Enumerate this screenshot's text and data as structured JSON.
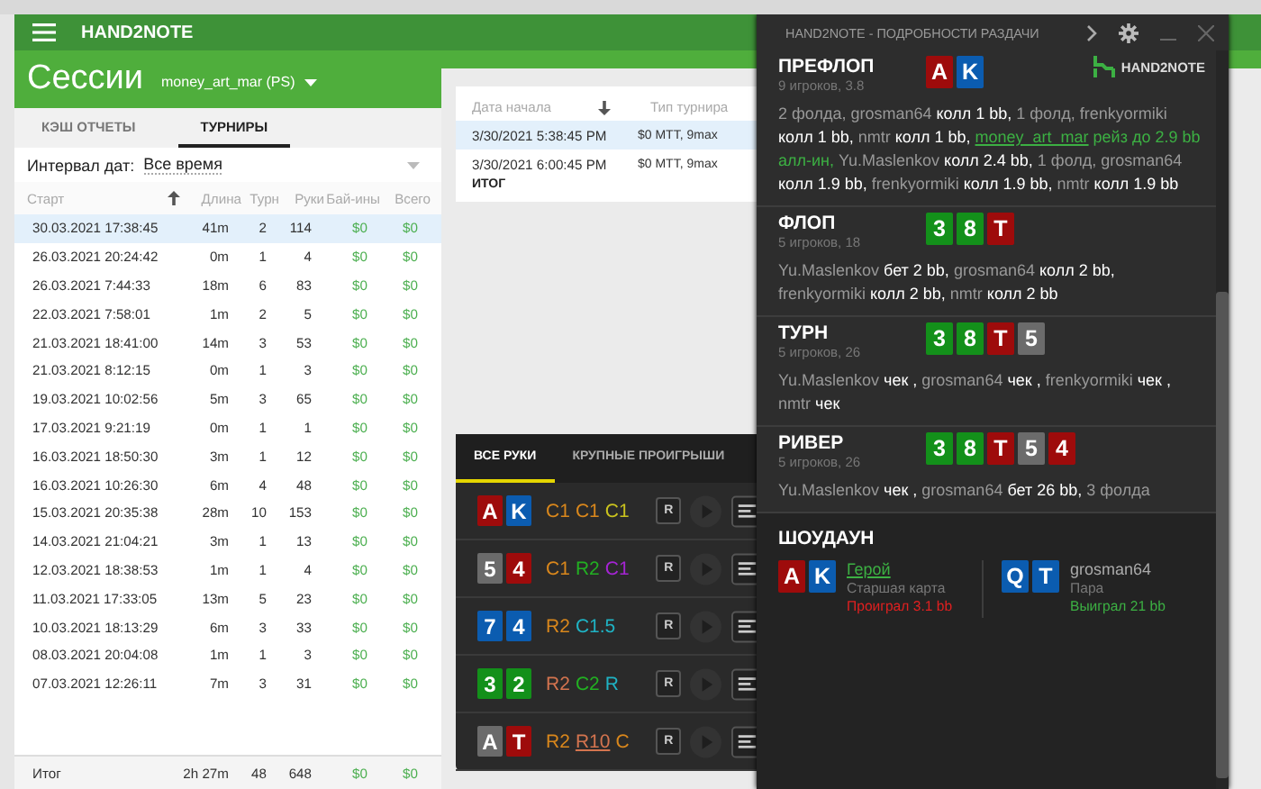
{
  "main_window": {
    "title": "HAND2NOTE",
    "heading": "Сессии",
    "account": "money_art_mar (PS)",
    "tabs": [
      {
        "label": "КЭШ ОТЧЕТЫ",
        "selected": false
      },
      {
        "label": "ТУРНИРЫ",
        "selected": true
      }
    ],
    "date_filter": {
      "label": "Интервал дат:",
      "value": "Все время"
    },
    "sessions": {
      "columns": [
        "Старт",
        "Длина",
        "Турн",
        "Руки",
        "Бай-ины",
        "Всего"
      ],
      "rows": [
        {
          "cells": [
            "30.03.2021 17:38:45",
            "41m",
            "2",
            "114",
            "$0",
            "$0"
          ],
          "selected": true
        },
        {
          "cells": [
            "26.03.2021 20:24:42",
            "0m",
            "1",
            "4",
            "$0",
            "$0"
          ],
          "selected": false
        },
        {
          "cells": [
            "26.03.2021 7:44:33",
            "18m",
            "6",
            "83",
            "$0",
            "$0"
          ],
          "selected": false
        },
        {
          "cells": [
            "22.03.2021 7:58:01",
            "1m",
            "2",
            "5",
            "$0",
            "$0"
          ],
          "selected": false
        },
        {
          "cells": [
            "21.03.2021 18:41:00",
            "14m",
            "3",
            "53",
            "$0",
            "$0"
          ],
          "selected": false
        },
        {
          "cells": [
            "21.03.2021 8:12:15",
            "0m",
            "1",
            "3",
            "$0",
            "$0"
          ],
          "selected": false
        },
        {
          "cells": [
            "19.03.2021 10:02:56",
            "5m",
            "3",
            "65",
            "$0",
            "$0"
          ],
          "selected": false
        },
        {
          "cells": [
            "17.03.2021 9:21:19",
            "0m",
            "1",
            "1",
            "$0",
            "$0"
          ],
          "selected": false
        },
        {
          "cells": [
            "16.03.2021 18:50:30",
            "3m",
            "1",
            "12",
            "$0",
            "$0"
          ],
          "selected": false
        },
        {
          "cells": [
            "16.03.2021 10:26:30",
            "6m",
            "4",
            "48",
            "$0",
            "$0"
          ],
          "selected": false
        },
        {
          "cells": [
            "15.03.2021 20:35:38",
            "28m",
            "10",
            "153",
            "$0",
            "$0"
          ],
          "selected": false
        },
        {
          "cells": [
            "14.03.2021 21:04:21",
            "3m",
            "1",
            "13",
            "$0",
            "$0"
          ],
          "selected": false
        },
        {
          "cells": [
            "12.03.2021 18:38:53",
            "1m",
            "1",
            "4",
            "$0",
            "$0"
          ],
          "selected": false
        },
        {
          "cells": [
            "11.03.2021 17:33:05",
            "13m",
            "5",
            "23",
            "$0",
            "$0"
          ],
          "selected": false
        },
        {
          "cells": [
            "10.03.2021 18:13:29",
            "6m",
            "3",
            "33",
            "$0",
            "$0"
          ],
          "selected": false
        },
        {
          "cells": [
            "08.03.2021 20:04:08",
            "1m",
            "1",
            "3",
            "$0",
            "$0"
          ],
          "selected": false
        },
        {
          "cells": [
            "07.03.2021 12:26:11",
            "7m",
            "3",
            "31",
            "$0",
            "$0"
          ],
          "selected": false
        }
      ],
      "totals": [
        "Итог",
        "2h 27m",
        "48",
        "648",
        "$0",
        "$0"
      ]
    },
    "tournaments": {
      "columns": [
        "Дата начала",
        "Тип турнира"
      ],
      "rows": [
        {
          "cells": [
            "3/30/2021 5:38:45 PM",
            "$0 MTT, 9max"
          ],
          "selected": true
        },
        {
          "cells": [
            "3/30/2021 6:00:45 PM",
            "$0 MTT, 9max"
          ],
          "selected": false
        }
      ],
      "total_label": "ИТОГ"
    }
  },
  "hands_panel": {
    "tabs": [
      {
        "label": "ВСЕ РУКИ",
        "selected": true
      },
      {
        "label": "КРУПНЫЕ ПРОИГРЫШИ",
        "selected": false
      }
    ],
    "hands": [
      {
        "replay_label": "R",
        "cards": [
          {
            "rank": "A",
            "color": "#9e0b0b"
          },
          {
            "rank": "K",
            "color": "#0b5cb0"
          }
        ],
        "actions": [
          {
            "text": "C1",
            "color": "#d9871c",
            "underlined": false
          },
          {
            "text": "C1",
            "color": "#d9871c",
            "underlined": false
          },
          {
            "text": "C1",
            "color": "#c9c21e",
            "underlined": false
          }
        ]
      },
      {
        "replay_label": "R",
        "cards": [
          {
            "rank": "5",
            "color": "#6b6b6b"
          },
          {
            "rank": "4",
            "color": "#9e0b0b"
          }
        ],
        "actions": [
          {
            "text": "C1",
            "color": "#d9871c",
            "underlined": false
          },
          {
            "text": "R2",
            "color": "#22b022",
            "underlined": false
          },
          {
            "text": "C1",
            "color": "#a524d4",
            "underlined": false
          }
        ]
      },
      {
        "replay_label": "R",
        "cards": [
          {
            "rank": "7",
            "color": "#0b5cb0"
          },
          {
            "rank": "4",
            "color": "#0b5cb0"
          }
        ],
        "actions": [
          {
            "text": "R2",
            "color": "#d9871c",
            "underlined": false
          },
          {
            "text": "C1.5",
            "color": "#1fb3c4",
            "underlined": false
          }
        ]
      },
      {
        "replay_label": "R",
        "cards": [
          {
            "rank": "3",
            "color": "#13901a"
          },
          {
            "rank": "2",
            "color": "#13901a"
          }
        ],
        "actions": [
          {
            "text": "R2",
            "color": "#d4744f",
            "underlined": false
          },
          {
            "text": "C2",
            "color": "#22b022",
            "underlined": false
          },
          {
            "text": "R",
            "color": "#1fb3c4",
            "underlined": false
          }
        ]
      },
      {
        "replay_label": "R",
        "cards": [
          {
            "rank": "A",
            "color": "#6b6b6b"
          },
          {
            "rank": "T",
            "color": "#9e0b0b"
          }
        ],
        "actions": [
          {
            "text": "R2",
            "color": "#d9871c",
            "underlined": false
          },
          {
            "text": "R10",
            "color": "#d4744f",
            "underlined": true
          },
          {
            "text": "C",
            "color": "#d9871c",
            "underlined": false
          }
        ]
      }
    ]
  },
  "hand_details": {
    "title": "HAND2NOTE - ПОДРОБНОСТИ РАЗДАЧИ",
    "logo": "HAND2NOTE",
    "streets": [
      {
        "name": "ПРЕФЛОП",
        "info": "9 игроков, 3.8",
        "cards": [
          {
            "rank": "A",
            "color": "#9e0b0b"
          },
          {
            "rank": "K",
            "color": "#0b5cb0"
          }
        ],
        "actions": [
          {
            "kind": "player",
            "text": "2 фолда, grosman64 "
          },
          {
            "kind": "action",
            "text": "колл 1 bb,"
          },
          {
            "kind": "player",
            "text": " 1 фолд, frenkyormiki "
          },
          {
            "kind": "action",
            "text": "колл 1 bb,"
          },
          {
            "kind": "player",
            "text": " nmtr "
          },
          {
            "kind": "action",
            "text": "колл 1 bb, "
          },
          {
            "kind": "hero_player",
            "text": "money_art_mar"
          },
          {
            "kind": "hero_action",
            "text": " рейз до 2.9 bb алл-ин,"
          },
          {
            "kind": "player",
            "text": " Yu.Maslenkov "
          },
          {
            "kind": "action",
            "text": "колл 2.4 bb,"
          },
          {
            "kind": "player",
            "text": " 1 фолд, grosman64 "
          },
          {
            "kind": "action",
            "text": "колл 1.9 bb,"
          },
          {
            "kind": "player",
            "text": " frenkyormiki "
          },
          {
            "kind": "action",
            "text": "колл 1.9 bb,"
          },
          {
            "kind": "player",
            "text": " nmtr "
          },
          {
            "kind": "action",
            "text": "колл 1.9 bb"
          }
        ]
      },
      {
        "name": "ФЛОП",
        "info": "5 игроков, 18",
        "cards": [
          {
            "rank": "3",
            "color": "#13901a"
          },
          {
            "rank": "8",
            "color": "#13901a"
          },
          {
            "rank": "T",
            "color": "#9e0b0b"
          }
        ],
        "actions": [
          {
            "kind": "player",
            "text": "Yu.Maslenkov "
          },
          {
            "kind": "action",
            "text": "бет 2 bb,"
          },
          {
            "kind": "player",
            "text": " grosman64 "
          },
          {
            "kind": "action",
            "text": "колл 2 bb,"
          },
          {
            "kind": "player",
            "text": " frenkyormiki "
          },
          {
            "kind": "action",
            "text": "колл 2 bb,"
          },
          {
            "kind": "player",
            "text": " nmtr "
          },
          {
            "kind": "action",
            "text": "колл 2 bb"
          }
        ]
      },
      {
        "name": "ТУРН",
        "info": "5 игроков, 26",
        "cards": [
          {
            "rank": "3",
            "color": "#13901a"
          },
          {
            "rank": "8",
            "color": "#13901a"
          },
          {
            "rank": "T",
            "color": "#9e0b0b"
          },
          {
            "rank": "5",
            "color": "#6b6b6b"
          }
        ],
        "actions": [
          {
            "kind": "player",
            "text": "Yu.Maslenkov "
          },
          {
            "kind": "action",
            "text": "чек ,"
          },
          {
            "kind": "player",
            "text": " grosman64 "
          },
          {
            "kind": "action",
            "text": "чек ,"
          },
          {
            "kind": "player",
            "text": " frenkyormiki "
          },
          {
            "kind": "action",
            "text": "чек ,"
          },
          {
            "kind": "player",
            "text": " nmtr "
          },
          {
            "kind": "action",
            "text": "чек"
          }
        ]
      },
      {
        "name": "РИВЕР",
        "info": "5 игроков, 26",
        "cards": [
          {
            "rank": "3",
            "color": "#13901a"
          },
          {
            "rank": "8",
            "color": "#13901a"
          },
          {
            "rank": "T",
            "color": "#9e0b0b"
          },
          {
            "rank": "5",
            "color": "#6b6b6b"
          },
          {
            "rank": "4",
            "color": "#9e0b0b"
          }
        ],
        "actions": [
          {
            "kind": "player",
            "text": "Yu.Maslenkov "
          },
          {
            "kind": "action",
            "text": "чек ,"
          },
          {
            "kind": "player",
            "text": " grosman64 "
          },
          {
            "kind": "action",
            "text": "бет 26 bb,"
          },
          {
            "kind": "player",
            "text": " 3 фолда"
          }
        ]
      }
    ],
    "showdown": {
      "title": "ШОУДАУН",
      "players": [
        {
          "name": "Герой",
          "hero": true,
          "hand": "Старшая карта",
          "result": "Проиграл 3.1 bb",
          "color": "#e02020",
          "cards": [
            {
              "rank": "A",
              "color": "#9e0b0b"
            },
            {
              "rank": "K",
              "color": "#0b5cb0"
            }
          ]
        },
        {
          "name": "grosman64",
          "hero": false,
          "hand": "Пара",
          "result": "Выиграл 21 bb",
          "color": "#3cb043",
          "cards": [
            {
              "rank": "Q",
              "color": "#0b5cb0"
            },
            {
              "rank": "T",
              "color": "#0b5cb0"
            }
          ]
        }
      ]
    }
  }
}
